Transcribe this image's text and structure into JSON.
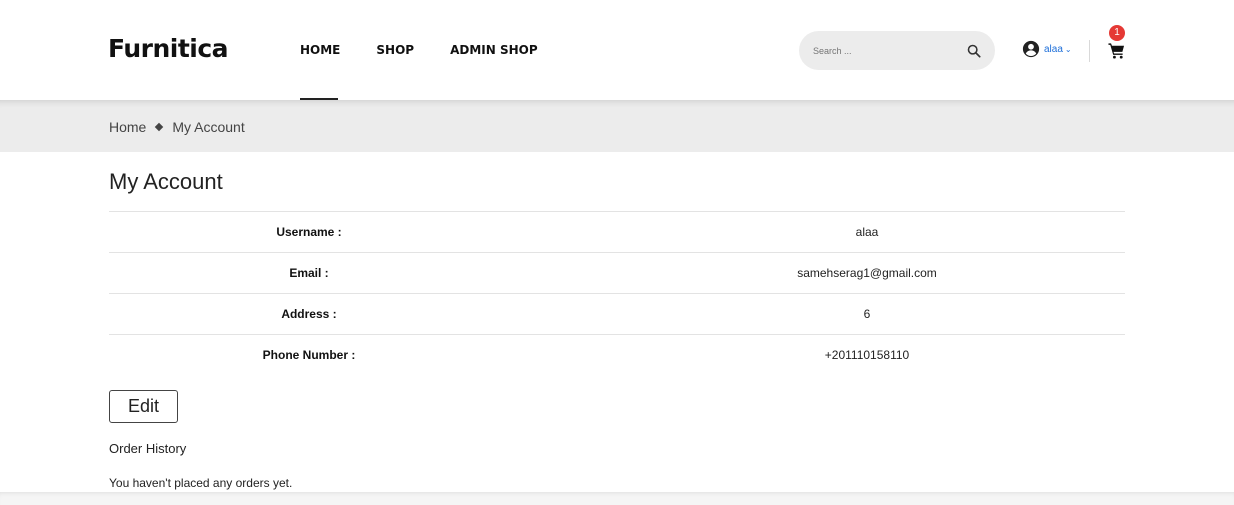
{
  "header": {
    "logo": "Furnitica",
    "nav": [
      {
        "label": "HOME",
        "active": true
      },
      {
        "label": "SHOP",
        "active": false
      },
      {
        "label": "ADMIN SHOP",
        "active": false
      }
    ],
    "search": {
      "placeholder": "Search ..."
    },
    "user": {
      "name": "alaa",
      "icon": "user-circle-icon"
    },
    "cart": {
      "count": "1",
      "icon": "shopping-cart-icon"
    }
  },
  "breadcrumb": {
    "home": "Home",
    "current": "My Account"
  },
  "account": {
    "title": "My Account",
    "rows": [
      {
        "label": "Username :",
        "value": "alaa"
      },
      {
        "label": "Email :",
        "value": "samehserag1@gmail.com"
      },
      {
        "label": "Address :",
        "value": "6"
      },
      {
        "label": "Phone Number :",
        "value": "+201110158110"
      }
    ],
    "edit_label": "Edit"
  },
  "orders": {
    "title": "Order History",
    "empty_message": "You haven't placed any orders yet."
  },
  "colors": {
    "accent": "#1e6fd9",
    "badge": "#e53935",
    "breadcrumb_bg": "#ececec"
  }
}
